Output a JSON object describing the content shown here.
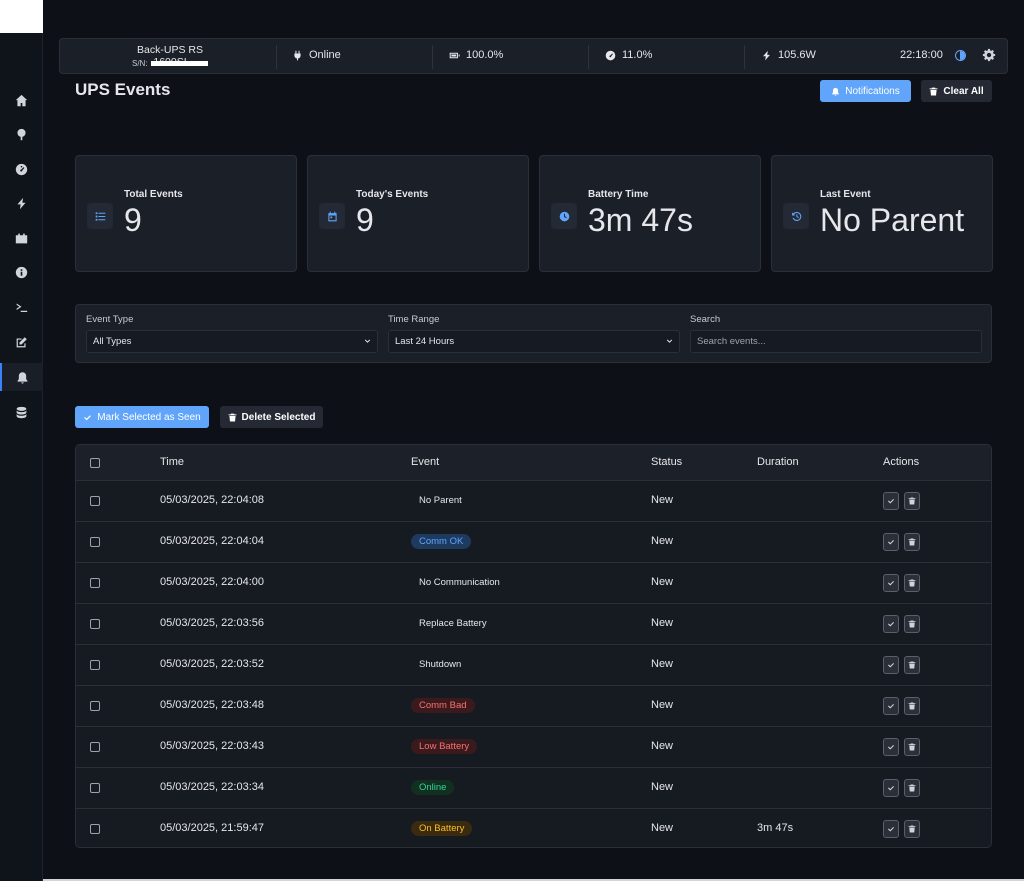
{
  "status_bar": {
    "model": "Back-UPS RS 1600SI",
    "serial_label": "S/N:",
    "status": "Online",
    "battery": "100.0%",
    "load": "11.0%",
    "power": "105.6W",
    "time": "22:18:00"
  },
  "page": {
    "title": "UPS Events",
    "notifications_label": "Notifications",
    "clear_all_label": "Clear All"
  },
  "stats": [
    {
      "label": "Total Events",
      "value": "9",
      "icon": "list-icon"
    },
    {
      "label": "Today's Events",
      "value": "9",
      "icon": "calendar-icon"
    },
    {
      "label": "Battery Time",
      "value": "3m 47s",
      "icon": "clock-icon"
    },
    {
      "label": "Last Event",
      "value": "No Parent",
      "icon": "history-icon"
    }
  ],
  "filters": {
    "event_type_label": "Event Type",
    "event_type_value": "All Types",
    "time_range_label": "Time Range",
    "time_range_value": "Last 24 Hours",
    "search_label": "Search",
    "search_placeholder": "Search events..."
  },
  "bulk_actions": {
    "mark_seen_label": "Mark Selected as Seen",
    "delete_label": "Delete Selected"
  },
  "table": {
    "headers": {
      "time": "Time",
      "event": "Event",
      "status": "Status",
      "duration": "Duration",
      "actions": "Actions"
    },
    "rows": [
      {
        "time": "05/03/2025, 22:04:08",
        "event": "No Parent",
        "event_style": "plain",
        "status": "New",
        "duration": ""
      },
      {
        "time": "05/03/2025, 22:04:04",
        "event": "Comm OK",
        "event_style": "blue",
        "status": "New",
        "duration": ""
      },
      {
        "time": "05/03/2025, 22:04:00",
        "event": "No Communication",
        "event_style": "plain",
        "status": "New",
        "duration": ""
      },
      {
        "time": "05/03/2025, 22:03:56",
        "event": "Replace Battery",
        "event_style": "plain",
        "status": "New",
        "duration": ""
      },
      {
        "time": "05/03/2025, 22:03:52",
        "event": "Shutdown",
        "event_style": "plain",
        "status": "New",
        "duration": ""
      },
      {
        "time": "05/03/2025, 22:03:48",
        "event": "Comm Bad",
        "event_style": "red",
        "status": "New",
        "duration": ""
      },
      {
        "time": "05/03/2025, 22:03:43",
        "event": "Low Battery",
        "event_style": "red",
        "status": "New",
        "duration": ""
      },
      {
        "time": "05/03/2025, 22:03:34",
        "event": "Online",
        "event_style": "green",
        "status": "New",
        "duration": ""
      },
      {
        "time": "05/03/2025, 21:59:47",
        "event": "On Battery",
        "event_style": "orange",
        "status": "New",
        "duration": "3m 47s"
      }
    ]
  },
  "colors": {
    "accent": "#60a5fa",
    "background": "#0d1017",
    "card": "#1b1f27",
    "pill_blue_bg": "#1e3a5f",
    "pill_blue_fg": "#60a5fa",
    "pill_red_bg": "#3b1a1d",
    "pill_red_fg": "#f87171",
    "pill_green_bg": "#12301f",
    "pill_green_fg": "#34d399",
    "pill_orange_bg": "#3a2a10",
    "pill_orange_fg": "#fbbf24"
  },
  "sidebar_icons": [
    "home-icon",
    "map-pin-icon",
    "gauge-icon",
    "bolt-icon",
    "battery-icon",
    "info-icon",
    "terminal-icon",
    "edit-icon",
    "bell-icon",
    "database-icon"
  ]
}
